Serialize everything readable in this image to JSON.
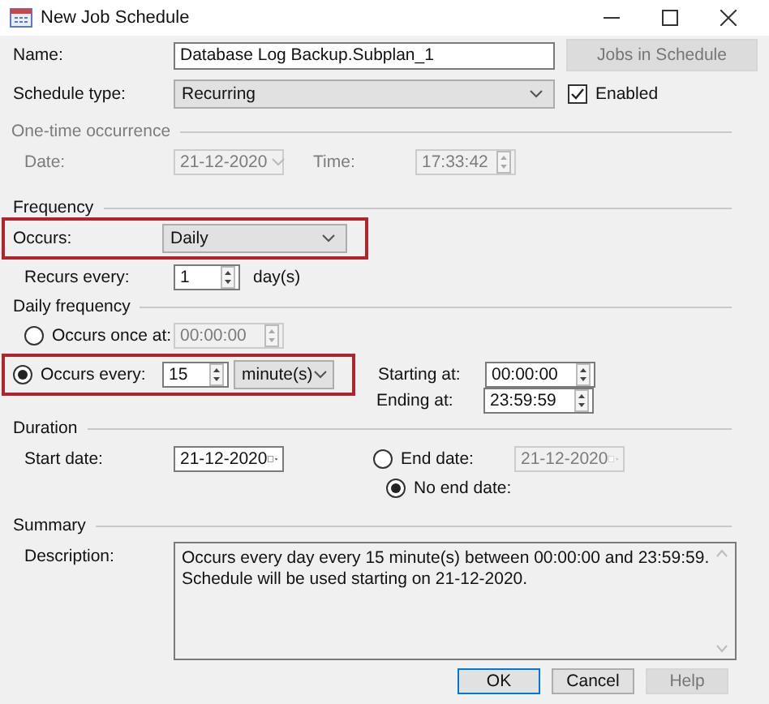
{
  "window": {
    "title": "New Job Schedule"
  },
  "name": {
    "label": "Name:",
    "value": "Database Log Backup.Subplan_1"
  },
  "jobs_button": {
    "label": "Jobs in Schedule",
    "disabled": true
  },
  "schedule_type": {
    "label": "Schedule type:",
    "value": "Recurring"
  },
  "enabled": {
    "label": "Enabled",
    "checked": true
  },
  "one_time": {
    "title": "One-time occurrence",
    "disabled": true,
    "date_label": "Date:",
    "date": "21-12-2020",
    "time_label": "Time:",
    "time": "17:33:42"
  },
  "frequency": {
    "title": "Frequency",
    "highlighted": true,
    "occurs_label": "Occurs:",
    "occurs": "Daily",
    "recurs_label": "Recurs every:",
    "recurs": "1",
    "recurs_unit": "day(s)"
  },
  "daily_frequency": {
    "title": "Daily frequency",
    "options": [
      {
        "label": "Occurs once at:",
        "selected": false,
        "value": "00:00:00"
      },
      {
        "label": "Occurs every:",
        "selected": true,
        "highlighted": true,
        "value": "15",
        "unit": "minute(s)"
      }
    ],
    "start_label": "Starting at:",
    "start": "00:00:00",
    "end_label": "Ending at:",
    "end": "23:59:59"
  },
  "duration": {
    "title": "Duration",
    "start_label": "Start date:",
    "start": "21-12-2020",
    "end_options": [
      {
        "label": "End date:",
        "selected": false,
        "value": "21-12-2020"
      },
      {
        "label": "No end date:",
        "selected": true
      }
    ]
  },
  "summary": {
    "title": "Summary",
    "label": "Description:",
    "text": "Occurs every day every 15 minute(s) between 00:00:00 and 23:59:59. Schedule will be used starting on 21-12-2020."
  },
  "buttons": [
    {
      "label": "OK",
      "disabled": false,
      "default": true
    },
    {
      "label": "Cancel",
      "disabled": false,
      "default": false
    },
    {
      "label": "Help",
      "disabled": true,
      "default": false
    }
  ]
}
